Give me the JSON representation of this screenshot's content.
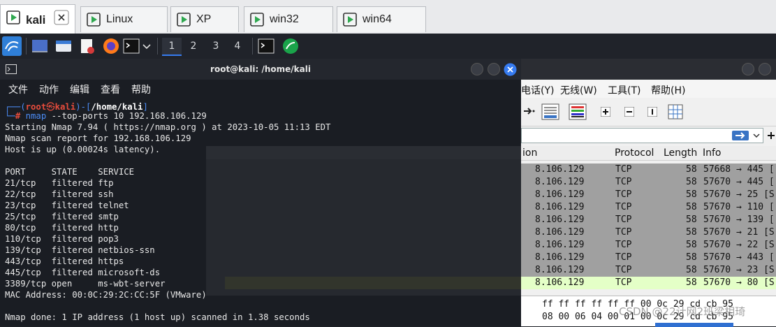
{
  "vm_tabs": [
    {
      "label": "kali",
      "active": true
    },
    {
      "label": "Linux",
      "active": false
    },
    {
      "label": "XP",
      "active": false
    },
    {
      "label": "win32",
      "active": false
    },
    {
      "label": "win64",
      "active": false
    }
  ],
  "panel": {
    "workspaces": [
      "1",
      "2",
      "3",
      "4"
    ]
  },
  "terminal": {
    "title": "root@kali: /home/kali",
    "menu": [
      "文件",
      "动作",
      "编辑",
      "查看",
      "帮助"
    ],
    "prompt": {
      "line1_prefix": "┌──(",
      "user": "root",
      "at": "㉿",
      "host": "kali",
      "mid": ")-[",
      "path": "/home/kali",
      "end": "]",
      "line2_prefix": "└─",
      "hash": "#",
      "cmd": "nmap",
      "args": " --top-ports 10 192.168.106.129"
    },
    "output": [
      "Starting Nmap 7.94 ( https://nmap.org ) at 2023-10-05 11:13 EDT",
      "Nmap scan report for 192.168.106.129",
      "Host is up (0.00024s latency).",
      "",
      "PORT     STATE    SERVICE",
      "21/tcp   filtered ftp",
      "22/tcp   filtered ssh",
      "23/tcp   filtered telnet",
      "25/tcp   filtered smtp",
      "80/tcp   filtered http",
      "110/tcp  filtered pop3",
      "139/tcp  filtered netbios-ssn",
      "443/tcp  filtered https",
      "445/tcp  filtered microsoft-ds",
      "3389/tcp open     ms-wbt-server",
      "MAC Address: 00:0C:29:2C:CC:5F (VMware)",
      "",
      "Nmap done: 1 IP address (1 host up) scanned in 1.38 seconds"
    ]
  },
  "wireshark": {
    "menu": [
      "电话(Y)",
      "无线(W)",
      "工具(T)",
      "帮助(H)"
    ],
    "columns": [
      "ion",
      "Protocol",
      "Length",
      "Info"
    ],
    "rows": [
      {
        "dest": "8.106.129",
        "proto": "TCP",
        "len": "58",
        "info": "57668 → 445 [",
        "selected": false
      },
      {
        "dest": "8.106.129",
        "proto": "TCP",
        "len": "58",
        "info": "57670 → 445 [",
        "selected": false
      },
      {
        "dest": "8.106.129",
        "proto": "TCP",
        "len": "58",
        "info": "57670 → 25 [S",
        "selected": false
      },
      {
        "dest": "8.106.129",
        "proto": "TCP",
        "len": "58",
        "info": "57670 → 110 [",
        "selected": false
      },
      {
        "dest": "8.106.129",
        "proto": "TCP",
        "len": "58",
        "info": "57670 → 139 [",
        "selected": false
      },
      {
        "dest": "8.106.129",
        "proto": "TCP",
        "len": "58",
        "info": "57670 → 21 [S",
        "selected": false
      },
      {
        "dest": "8.106.129",
        "proto": "TCP",
        "len": "58",
        "info": "57670 → 22 [S",
        "selected": false
      },
      {
        "dest": "8.106.129",
        "proto": "TCP",
        "len": "58",
        "info": "57670 → 443 [",
        "selected": false
      },
      {
        "dest": "8.106.129",
        "proto": "TCP",
        "len": "58",
        "info": "57670 → 23 [S",
        "selected": false
      },
      {
        "dest": "8.106.129",
        "proto": "TCP",
        "len": "58",
        "info": "57670 → 80 [S",
        "selected": true
      }
    ],
    "hex_rows": [
      "ff ff ff ff ff ff 00 0c 29 cd cb 95",
      "08 00 06 04 00 01 00 0c 29 cd cb 95"
    ],
    "watermark": "CSDN @22计网2班梁相琦"
  },
  "colors": {
    "accent": "#367bf0",
    "root_red": "#e74c3c",
    "prompt_blue": "#4c8cf5",
    "selected_row": "#e4ffc7",
    "row_grey": "#a0a0a0"
  }
}
